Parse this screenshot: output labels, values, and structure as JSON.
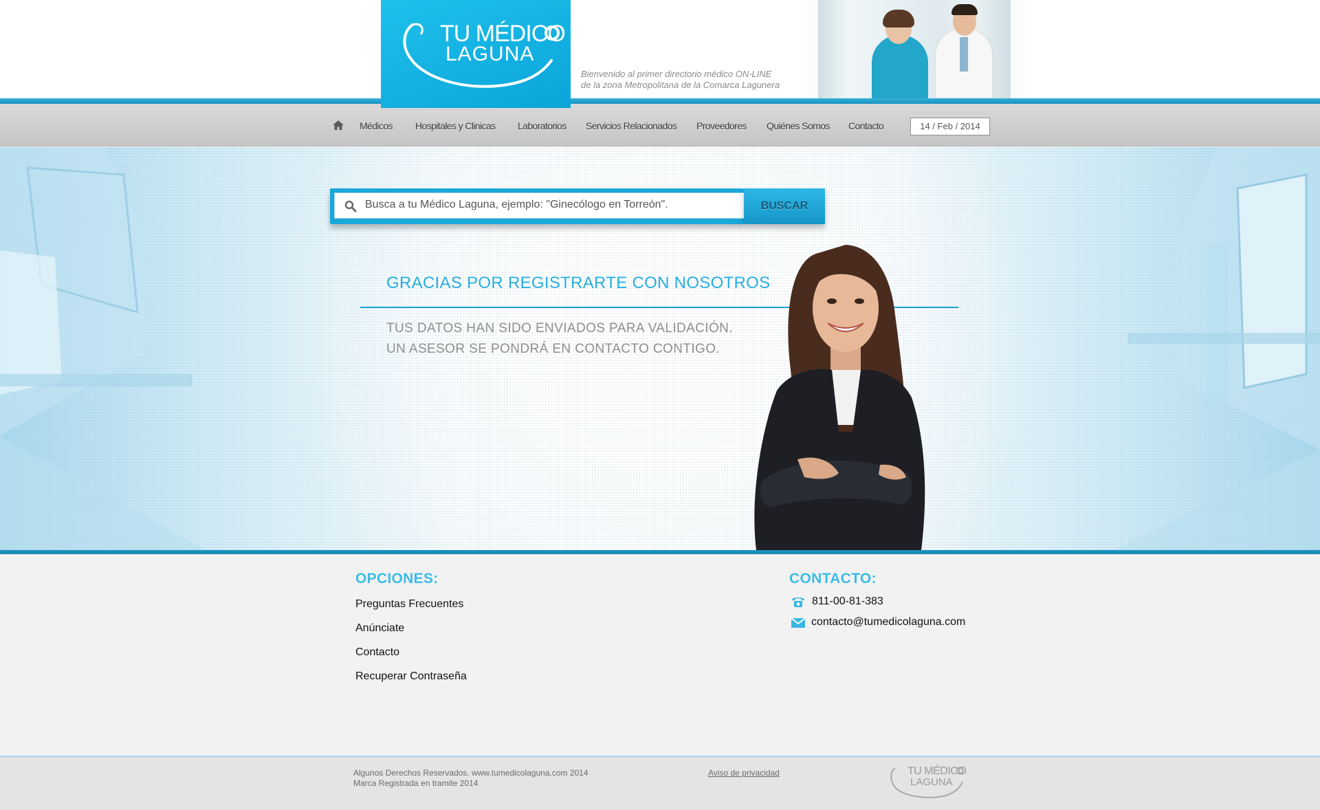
{
  "brand": {
    "logo_line1": "TU MÉDICO",
    "logo_line2": "LAGUNA",
    "tagline_line1": "Bienvenido al primer directorio médico ON-LINE",
    "tagline_line2": "de la zona Metropolitana de la Comarca Lagunera",
    "color_primary": "#1aa7da",
    "color_heading": "#28aee0"
  },
  "nav": {
    "home_icon": "home-icon",
    "items": [
      {
        "label": "Médicos"
      },
      {
        "label": "Hospitales y Clinicas"
      },
      {
        "label": "Laboratorios"
      },
      {
        "label": "Servicios Relacionados"
      },
      {
        "label": "Proveedores"
      },
      {
        "label": "Quiénes Somos"
      },
      {
        "label": "Contacto"
      }
    ],
    "date": "14 / Feb / 2014"
  },
  "search": {
    "placeholder": "Busca a tu Médico Laguna, ejemplo: \"Ginecólogo en Torreón\".",
    "button_label": "BUSCAR",
    "icon": "magnifier-icon"
  },
  "confirmation": {
    "title": "GRACIAS POR REGISTRARTE CON NOSOTROS",
    "line1": "TUS DATOS HAN SIDO ENVIADOS PARA VALIDACIÓN.",
    "line2": "UN ASESOR SE PONDRÁ EN CONTACTO CONTIGO."
  },
  "footer": {
    "options_heading": "OPCIONES:",
    "options": [
      {
        "label": "Preguntas Frecuentes"
      },
      {
        "label": "Anúnciate"
      },
      {
        "label": "Contacto"
      },
      {
        "label": "Recuperar Contraseña"
      }
    ],
    "contact_heading": "CONTACTO:",
    "phone": "811-00-81-383",
    "email": "contacto@tumedicolaguna.com",
    "phone_icon": "phone-icon",
    "email_icon": "envelope-icon"
  },
  "legal": {
    "copyright_line1": "Algunos Derechos Reservados. www.tumedicolaguna.com 2014",
    "copyright_line2": "Marca Registrada en tramite 2014",
    "privacy_link": "Aviso de privacidad",
    "mini_logo_line1": "TU MÉDICO",
    "mini_logo_line2": "LAGUNA"
  }
}
